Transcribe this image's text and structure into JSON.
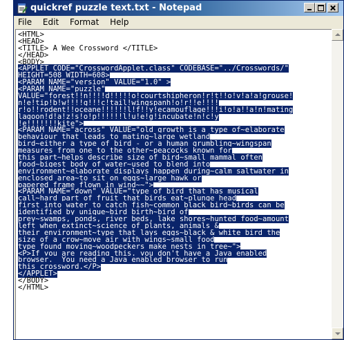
{
  "window": {
    "title": "quickref puzzle text.txt - Notepad"
  },
  "menu": [
    "File",
    "Edit",
    "Format",
    "Help"
  ],
  "document": {
    "lines": [
      {
        "text": "<HTML>",
        "selected": false
      },
      {
        "text": "<HEAD>",
        "selected": false
      },
      {
        "text": "<TITLE> A Wee Crossword </TITLE>",
        "selected": false
      },
      {
        "text": "</HEAD>",
        "selected": false
      },
      {
        "text": "<BODY>",
        "selected": false
      },
      {
        "text": "<APPLET CODE=\"CrosswordApplet.class\" CODEBASE=\"../Crosswords/\"",
        "selected": true
      },
      {
        "text": "HEIGHT=508 WIDTH=608>",
        "selected": true
      },
      {
        "text": "<PARAM NAME=\"version\" VALUE=\"1.0\" >",
        "selected": true
      },
      {
        "text": "<PARAM NAME=\"puzzle\"",
        "selected": true
      },
      {
        "text": "VALUE=\"forest!!n!!!!d!!!!!o!courtshipheron!r!t!!o!v!a!a!grouse!",
        "selected": true
      },
      {
        "text": "n!e!tip!b!w!!!!g!!!c!tail!wingspanh!o!r!!e!!!!",
        "selected": true
      },
      {
        "text": "r!o!!rodent!!oceane!!!!!!l!f!!y!ecamouflage!!!i!o!a!!a!n!mating",
        "selected": true
      },
      {
        "text": "lagoon!d!a!z!s!o!p!!!!!!l!u!e!g!incubate!n!c!y",
        "selected": true
      },
      {
        "text": "!e!!!!!!!kite\">",
        "selected": true
      },
      {
        "text": "<PARAM NAME=\"across\" VALUE=\"old growth is a type of~elaborate",
        "selected": true
      },
      {
        "text": "behaviour that leads to mating~large wetland",
        "selected": true
      },
      {
        "text": "bird~either a type of bird - or a human grumbling~wingspan",
        "selected": true
      },
      {
        "text": "measures from one to the other~peacocks known for",
        "selected": true
      },
      {
        "text": "this part~helps describe size of bird~small mammal often",
        "selected": true
      },
      {
        "text": "food~bigest body of water~used to blend into",
        "selected": true
      },
      {
        "text": "environment~elaborate displays happen during~calm saltwater in",
        "selected": true
      },
      {
        "text": "enclosed area~to sit on eggs~large hawk or",
        "selected": true
      },
      {
        "text": "papered frame flown in wind~~\">",
        "selected": true
      },
      {
        "text": "<PARAM NAME=\"down\" VALUE=\"type of bird that has musical",
        "selected": true
      },
      {
        "text": "call~hard part of fruit that birds eat~plunge head",
        "selected": true
      },
      {
        "text": "first into water to catch fish~common black bird~birds can be",
        "selected": true
      },
      {
        "text": "identified by unique~bird birth~bird of",
        "selected": true
      },
      {
        "text": "prey~swamps, ponds, river beds, lake shores~hunted food~amount",
        "selected": true
      },
      {
        "text": "left when extinct~science of plants, animals &",
        "selected": true
      },
      {
        "text": "their environment~type that lays eggs~black & white bird the",
        "selected": true
      },
      {
        "text": "size of a crow~move air with wings~small food",
        "selected": true
      },
      {
        "text": "type found moving~woodpeckers make nests in tree~\">",
        "selected": true
      },
      {
        "text": "<P>If you are reading this, you don't have a Java enabled",
        "selected": true
      },
      {
        "text": "browser.  You need a Java enabled browser to run",
        "selected": true
      },
      {
        "text": "this crossword.</P>",
        "selected": true
      },
      {
        "text": "</APPLET>",
        "selected": true
      },
      {
        "text": "</BODY>",
        "selected": false
      },
      {
        "text": "</HTML>",
        "selected": false
      }
    ]
  }
}
